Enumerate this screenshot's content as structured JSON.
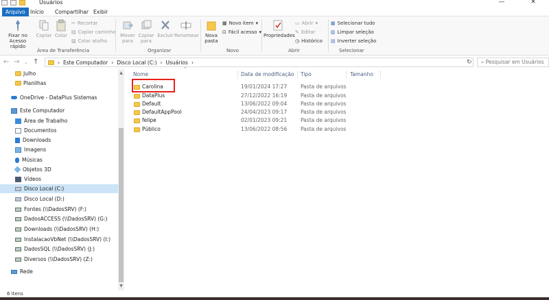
{
  "window": {
    "title": "Usuários",
    "minimize": "—",
    "close": "✕"
  },
  "tabs": [
    "Arquivo",
    "Início",
    "Compartilhar",
    "Exibir"
  ],
  "ribbon": {
    "clipboard": {
      "pin": "Fixar no Acesso rápido",
      "copy": "Copiar",
      "paste": "Colar",
      "cut": "Recortar",
      "copy_path": "Copiar caminho",
      "paste_shortcut": "Colar atalho",
      "label": "Área de Transferência"
    },
    "organize": {
      "move_to": "Mover para",
      "copy_to": "Copiar para",
      "delete": "Excluir",
      "rename": "Renomear",
      "label": "Organizar"
    },
    "new": {
      "new_folder": "Nova pasta",
      "new_item": "Novo item",
      "easy_access": "Fácil acesso",
      "label": "Novo"
    },
    "open": {
      "properties": "Propriedades",
      "open": "Abrir",
      "edit": "Editar",
      "history": "Histórico",
      "label": "Abrir"
    },
    "select": {
      "select_all": "Selecionar tudo",
      "select_none": "Limpar seleção",
      "invert": "Inverter seleção",
      "label": "Selecionar"
    }
  },
  "address": {
    "segments": [
      "›",
      "Este Computador",
      "›",
      "Disco Local (C:)",
      "›",
      "Usuários",
      "›"
    ],
    "search_placeholder": "Pesquisar em Usuários"
  },
  "nav": [
    {
      "label": "Julho",
      "icon": "folder-icon"
    },
    {
      "label": "Planilhas",
      "icon": "folder-icon"
    },
    {
      "label": "OneDrive - DataPlus Sistemas",
      "icon": "cloud-icon"
    },
    {
      "label": "Este Computador",
      "icon": "computer-icon"
    },
    {
      "label": "Área de Trabalho",
      "icon": "desktop-icon"
    },
    {
      "label": "Documentos",
      "icon": "documents-icon"
    },
    {
      "label": "Downloads",
      "icon": "downloads-icon"
    },
    {
      "label": "Imagens",
      "icon": "images-icon"
    },
    {
      "label": "Músicas",
      "icon": "music-icon"
    },
    {
      "label": "Objetos 3D",
      "icon": "objects3d-icon"
    },
    {
      "label": "Vídeos",
      "icon": "videos-icon"
    },
    {
      "label": "Disco Local (C:)",
      "icon": "drive-icon"
    },
    {
      "label": "Disco Local (D:)",
      "icon": "drive-icon"
    },
    {
      "label": "Fontes (\\\\DadosSRV) (F:)",
      "icon": "network-drive-icon"
    },
    {
      "label": "DadosACCESS (\\\\DadosSRV) (G:)",
      "icon": "network-drive-icon"
    },
    {
      "label": "Downloads (\\\\DadosSRV) (H:)",
      "icon": "network-drive-icon"
    },
    {
      "label": "InstalacaoVbNet (\\\\DadosSRV) (I:)",
      "icon": "network-drive-icon"
    },
    {
      "label": "DadosSQL (\\\\DadosSRV) (J:)",
      "icon": "network-drive-icon"
    },
    {
      "label": "Diversos (\\\\DadosSRV) (Z:)",
      "icon": "network-drive-icon"
    },
    {
      "label": "Rede",
      "icon": "network-icon"
    }
  ],
  "columns": {
    "name": "Nome",
    "date": "Data de modificação",
    "type": "Tipo",
    "size": "Tamanho"
  },
  "files": [
    {
      "name": "Carolina",
      "date": "19/01/2024 17:27",
      "type": "Pasta de arquivos"
    },
    {
      "name": "DataPlus",
      "date": "27/12/2022 16:19",
      "type": "Pasta de arquivos"
    },
    {
      "name": "Default",
      "date": "13/06/2022 09:04",
      "type": "Pasta de arquivos"
    },
    {
      "name": "DefaultAppPool",
      "date": "24/04/2023 09:17",
      "type": "Pasta de arquivos"
    },
    {
      "name": "felipe",
      "date": "02/01/2023 09:21",
      "type": "Pasta de arquivos"
    },
    {
      "name": "Público",
      "date": "13/06/2022 08:56",
      "type": "Pasta de arquivos"
    }
  ],
  "status": {
    "count": "6 itens"
  }
}
